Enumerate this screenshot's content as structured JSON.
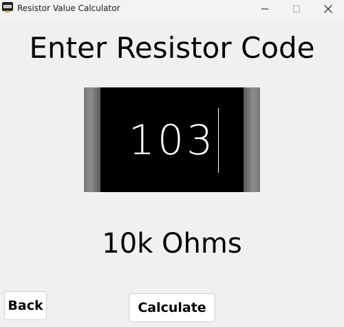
{
  "window": {
    "title": "Resistor Value Calculator",
    "app_icon": "resistor-app-icon",
    "controls": [
      "minimize-icon",
      "maximize-icon",
      "close-icon"
    ]
  },
  "main": {
    "heading": "Enter Resistor Code",
    "code_value": "103",
    "result": "10k Ohms"
  },
  "buttons": {
    "back_label": "Back",
    "calculate_label": "Calculate"
  },
  "colors": {
    "window_background": "#f0f0f0",
    "resistor_body": "#000000",
    "resistor_caps": "#7a7a7a",
    "code_text": "#ffffff"
  }
}
